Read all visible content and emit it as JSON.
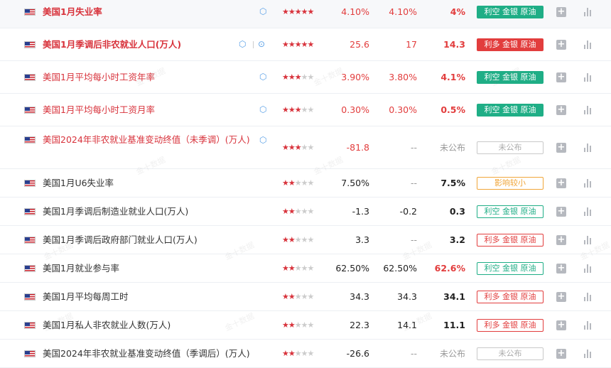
{
  "colors": {
    "bearish_green": "#1fae86",
    "bullish_red": "#e23d3d",
    "neutral_gray": "#999999",
    "small_impact_orange": "#f0a63a",
    "star_red": "#d8333c"
  },
  "watermark_text": "金十数据",
  "rows": [
    {
      "name": "美国1月失业率",
      "importance": 5,
      "prev": "4.10%",
      "forecast": "4.10%",
      "actual": "4%",
      "tag": "利空 金银 原油",
      "icons": [
        "cube-icon"
      ]
    },
    {
      "name": "美国1月季调后非农就业人口(万人)",
      "importance": 5,
      "prev": "25.6",
      "forecast": "17",
      "actual": "14.3",
      "tag": "利多 金银 原油",
      "icons": [
        "cube-icon",
        "play-icon"
      ]
    },
    {
      "name": "美国1月平均每小时工资年率",
      "importance": 3,
      "prev": "3.90%",
      "forecast": "3.80%",
      "actual": "4.1%",
      "tag": "利空 金银 原油",
      "icons": [
        "cube-icon"
      ]
    },
    {
      "name": "美国1月平均每小时工资月率",
      "importance": 3,
      "prev": "0.30%",
      "forecast": "0.30%",
      "actual": "0.5%",
      "tag": "利空 金银 原油",
      "icons": [
        "cube-icon"
      ]
    },
    {
      "name": "美国2024年非农就业基准变动终值（未季调）(万人)",
      "importance": 3,
      "prev": "-81.8",
      "forecast": "--",
      "actual": "未公布",
      "tag": "未公布",
      "icons": [
        "cube-icon"
      ]
    },
    {
      "name": "美国1月U6失业率",
      "importance": 2,
      "prev": "7.50%",
      "forecast": "--",
      "actual": "7.5%",
      "tag": "影响较小",
      "icons": []
    },
    {
      "name": "美国1月季调后制造业就业人口(万人)",
      "importance": 2,
      "prev": "-1.3",
      "forecast": "-0.2",
      "actual": "0.3",
      "tag": "利空 金银 原油",
      "icons": []
    },
    {
      "name": "美国1月季调后政府部门就业人口(万人)",
      "importance": 2,
      "prev": "3.3",
      "forecast": "--",
      "actual": "3.2",
      "tag": "利多 金银 原油",
      "icons": []
    },
    {
      "name": "美国1月就业参与率",
      "importance": 2,
      "prev": "62.50%",
      "forecast": "62.50%",
      "actual": "62.6%",
      "tag": "利空 金银 原油",
      "icons": []
    },
    {
      "name": "美国1月平均每周工时",
      "importance": 2,
      "prev": "34.3",
      "forecast": "34.3",
      "actual": "34.1",
      "tag": "利多 金银 原油",
      "icons": []
    },
    {
      "name": "美国1月私人非农就业人数(万人)",
      "importance": 2,
      "prev": "22.3",
      "forecast": "14.1",
      "actual": "11.1",
      "tag": "利多 金银 原油",
      "icons": []
    },
    {
      "name": "美国2024年非农就业基准变动终值（季调后）(万人)",
      "importance": 2,
      "prev": "-26.6",
      "forecast": "--",
      "actual": "未公布",
      "tag": "未公布",
      "icons": []
    }
  ]
}
